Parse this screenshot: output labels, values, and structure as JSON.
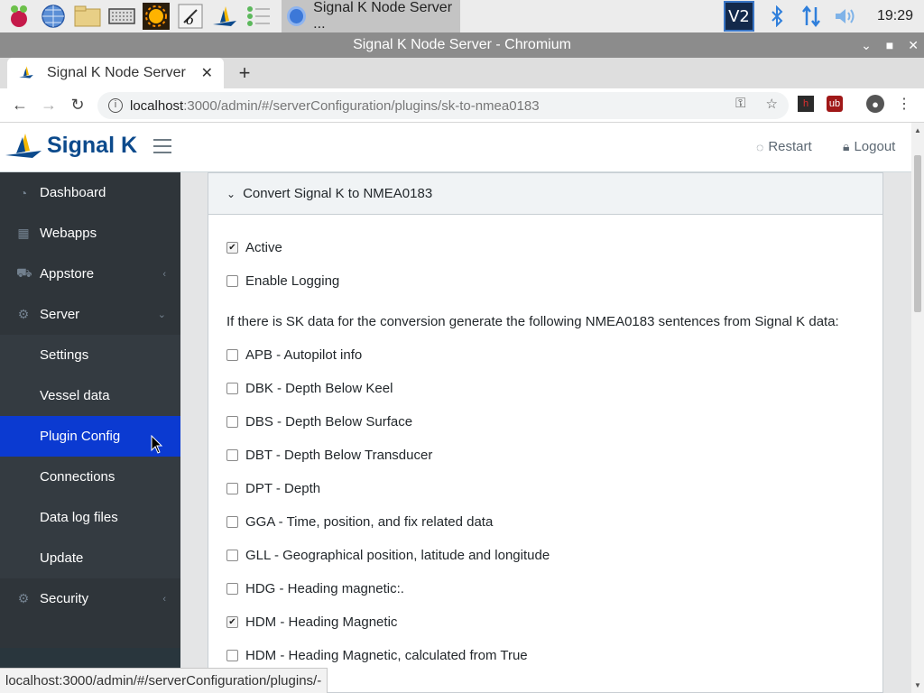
{
  "taskbar": {
    "active_task": "Signal K Node Server ...",
    "clock": "19:29",
    "vnc_label": "V2",
    "icons": [
      "raspberry-icon",
      "globe-icon",
      "folder-icon",
      "keyboard-icon",
      "sun-icon",
      "text-editor-icon",
      "signalk-icon",
      "list-icon"
    ]
  },
  "window": {
    "title": "Signal K Node Server - Chromium"
  },
  "browser": {
    "tab_title": "Signal K Node Server",
    "url_host": "localhost",
    "url_path": ":3000/admin/#/serverConfiguration/plugins/sk-to-nmea0183",
    "status_url": "localhost:3000/admin/#/serverConfiguration/plugins/-"
  },
  "header": {
    "logo_text": "Signal K",
    "restart_label": "Restart",
    "logout_label": "Logout"
  },
  "sidebar": {
    "items": [
      {
        "label": "Dashboard",
        "icon": "dashboard-icon"
      },
      {
        "label": "Webapps",
        "icon": "grid-icon"
      },
      {
        "label": "Appstore",
        "icon": "cart-icon"
      },
      {
        "label": "Server",
        "icon": "gear-icon"
      },
      {
        "label": "Settings"
      },
      {
        "label": "Vessel data"
      },
      {
        "label": "Plugin Config"
      },
      {
        "label": "Connections"
      },
      {
        "label": "Data log files"
      },
      {
        "label": "Update"
      },
      {
        "label": "Security",
        "icon": "gear-icon"
      }
    ],
    "active_color": "#0b3ad1"
  },
  "plugin": {
    "title": "Convert Signal K to NMEA0183",
    "active_label": "Active",
    "active_checked": true,
    "logging_label": "Enable Logging",
    "logging_checked": false,
    "description": "If there is SK data for the conversion generate the following NMEA0183 sentences from Signal K data:",
    "sentences": [
      {
        "label": "APB - Autopilot info",
        "checked": false
      },
      {
        "label": "DBK - Depth Below Keel",
        "checked": false
      },
      {
        "label": "DBS - Depth Below Surface",
        "checked": false
      },
      {
        "label": "DBT - Depth Below Transducer",
        "checked": false
      },
      {
        "label": "DPT - Depth",
        "checked": false
      },
      {
        "label": "GGA - Time, position, and fix related data",
        "checked": false
      },
      {
        "label": "GLL - Geographical position, latitude and longitude",
        "checked": false
      },
      {
        "label": "HDG - Heading magnetic:.",
        "checked": false
      },
      {
        "label": "HDM - Heading Magnetic",
        "checked": true
      },
      {
        "label": "HDM - Heading Magnetic, calculated from True",
        "checked": false
      }
    ]
  }
}
